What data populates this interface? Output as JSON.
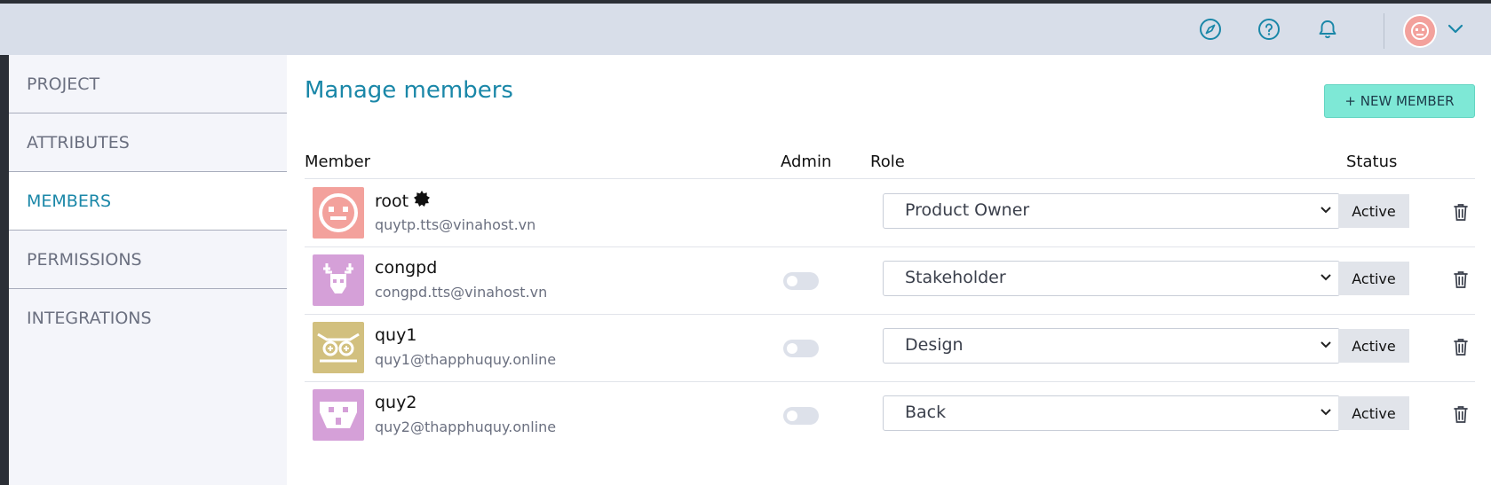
{
  "header": {
    "icons": [
      "compass-icon",
      "help-icon",
      "bell-icon"
    ]
  },
  "sidebar": {
    "items": [
      {
        "label": "PROJECT"
      },
      {
        "label": "ATTRIBUTES"
      },
      {
        "label": "MEMBERS"
      },
      {
        "label": "PERMISSIONS"
      },
      {
        "label": "INTEGRATIONS"
      }
    ],
    "active": "MEMBERS"
  },
  "main": {
    "title": "Manage members",
    "new_member_label": "+ NEW MEMBER",
    "columns": {
      "member": "Member",
      "admin": "Admin",
      "role": "Role",
      "status": "Status"
    },
    "members": [
      {
        "name": "root",
        "email": "quytp.tts@vinahost.vn",
        "role": "Product Owner",
        "status": "Active",
        "is_owner": true,
        "avatar_color": "#f3a19c"
      },
      {
        "name": "congpd",
        "email": "congpd.tts@vinahost.vn",
        "role": "Stakeholder",
        "status": "Active",
        "admin": false,
        "avatar_color": "#d5a0d8"
      },
      {
        "name": "quy1",
        "email": "quy1@thapphuquy.online",
        "role": "Design",
        "status": "Active",
        "admin": false,
        "avatar_color": "#d2c07f"
      },
      {
        "name": "quy2",
        "email": "quy2@thapphuquy.online",
        "role": "Back",
        "status": "Active",
        "admin": false,
        "avatar_color": "#d5a0d8"
      }
    ]
  },
  "colors": {
    "accent": "#1a87a8",
    "button": "#7ee8d6",
    "header_bg": "#d8dee9"
  }
}
